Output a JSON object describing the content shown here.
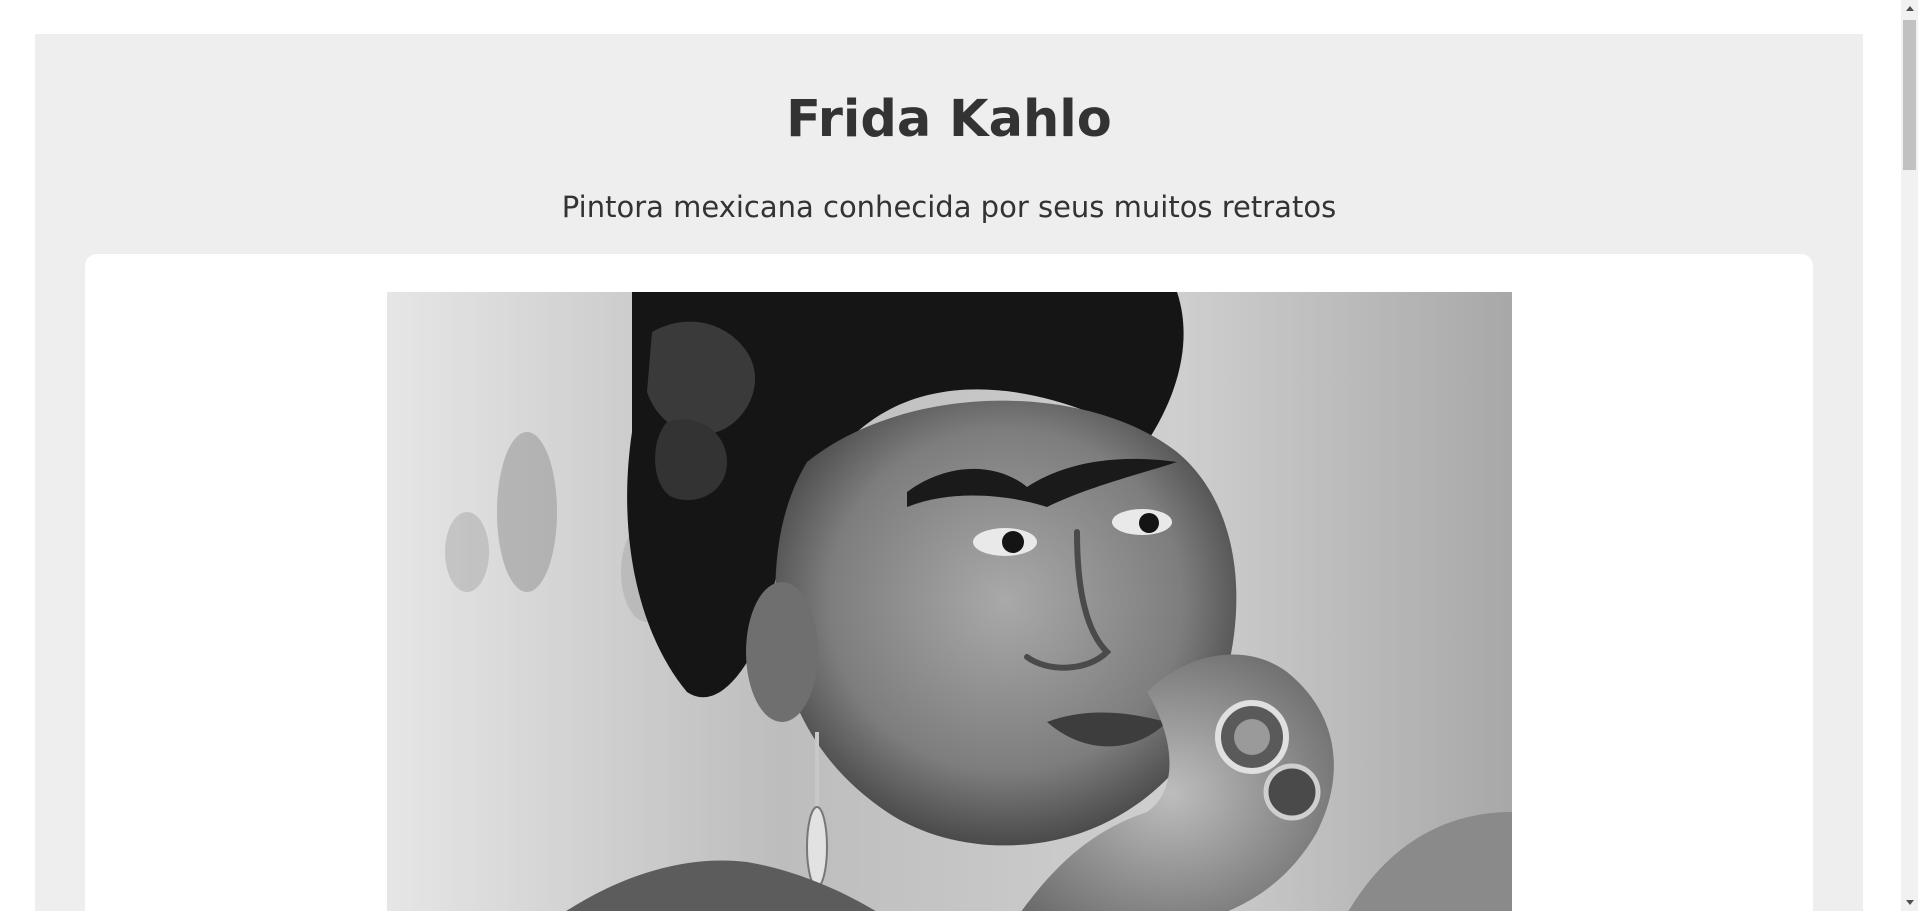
{
  "profile": {
    "name": "Frida Kahlo",
    "tagline": "Pintora mexicana conhecida por seus muitos retratos"
  },
  "photo": {
    "description_icon": "portrait-photo"
  },
  "colors": {
    "page_background": "#ffffff",
    "main_background": "#eeeeee",
    "card_background": "#ffffff",
    "text": "#333333",
    "scrollbar_track": "#f1f1f1",
    "scrollbar_thumb": "#c1c1c1"
  }
}
